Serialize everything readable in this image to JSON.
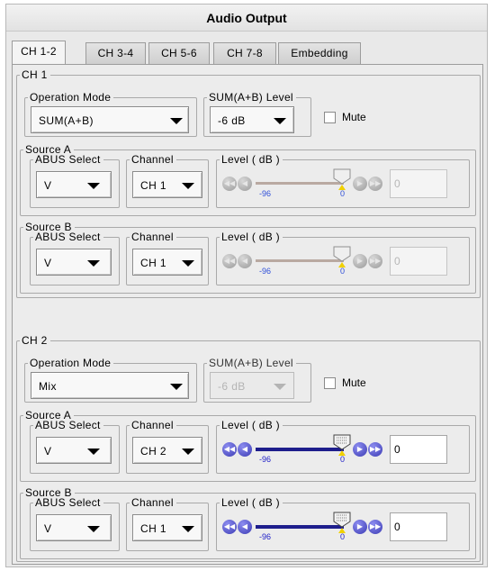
{
  "window": {
    "title": "Audio Output"
  },
  "tabs": [
    {
      "label": "CH 1-2",
      "active": true
    },
    {
      "label": "CH 3-4",
      "active": false
    },
    {
      "label": "CH 5-6",
      "active": false
    },
    {
      "label": "CH 7-8",
      "active": false
    },
    {
      "label": "Embedding",
      "active": false
    }
  ],
  "labels": {
    "operation_mode": "Operation Mode",
    "sum_level": "SUM(A+B) Level",
    "mute": "Mute",
    "source_a": "Source A",
    "source_b": "Source B",
    "abus_select": "ABUS Select",
    "channel": "Channel",
    "level_db": "Level ( dB )",
    "slider_min": "-96",
    "slider_zero": "0"
  },
  "channels": [
    {
      "title": "CH 1",
      "operation_mode": "SUM(A+B)",
      "sum_level": "-6 dB",
      "sum_level_enabled": true,
      "mute": false,
      "source_a": {
        "abus": "V",
        "channel": "CH 1",
        "level_value": "0",
        "level_enabled": false
      },
      "source_b": {
        "abus": "V",
        "channel": "CH 1",
        "level_value": "0",
        "level_enabled": false
      }
    },
    {
      "title": "CH 2",
      "operation_mode": "Mix",
      "sum_level": "-6 dB",
      "sum_level_enabled": false,
      "mute": false,
      "source_a": {
        "abus": "V",
        "channel": "CH 2",
        "level_value": "0",
        "level_enabled": true
      },
      "source_b": {
        "abus": "V",
        "channel": "CH 1",
        "level_value": "0",
        "level_enabled": true
      }
    }
  ],
  "icons": {
    "first": "double-chevron-left-icon",
    "prev": "chevron-left-icon",
    "next": "chevron-right-icon",
    "last": "double-chevron-right-icon",
    "thumb": "slider-thumb-icon"
  },
  "colors": {
    "active_button": "#3b3bb4",
    "disabled_button": "#9a9a9a",
    "track_active": "#1e1e8c",
    "zero_marker": "#f0d000",
    "tick_label": "#2020c8"
  }
}
